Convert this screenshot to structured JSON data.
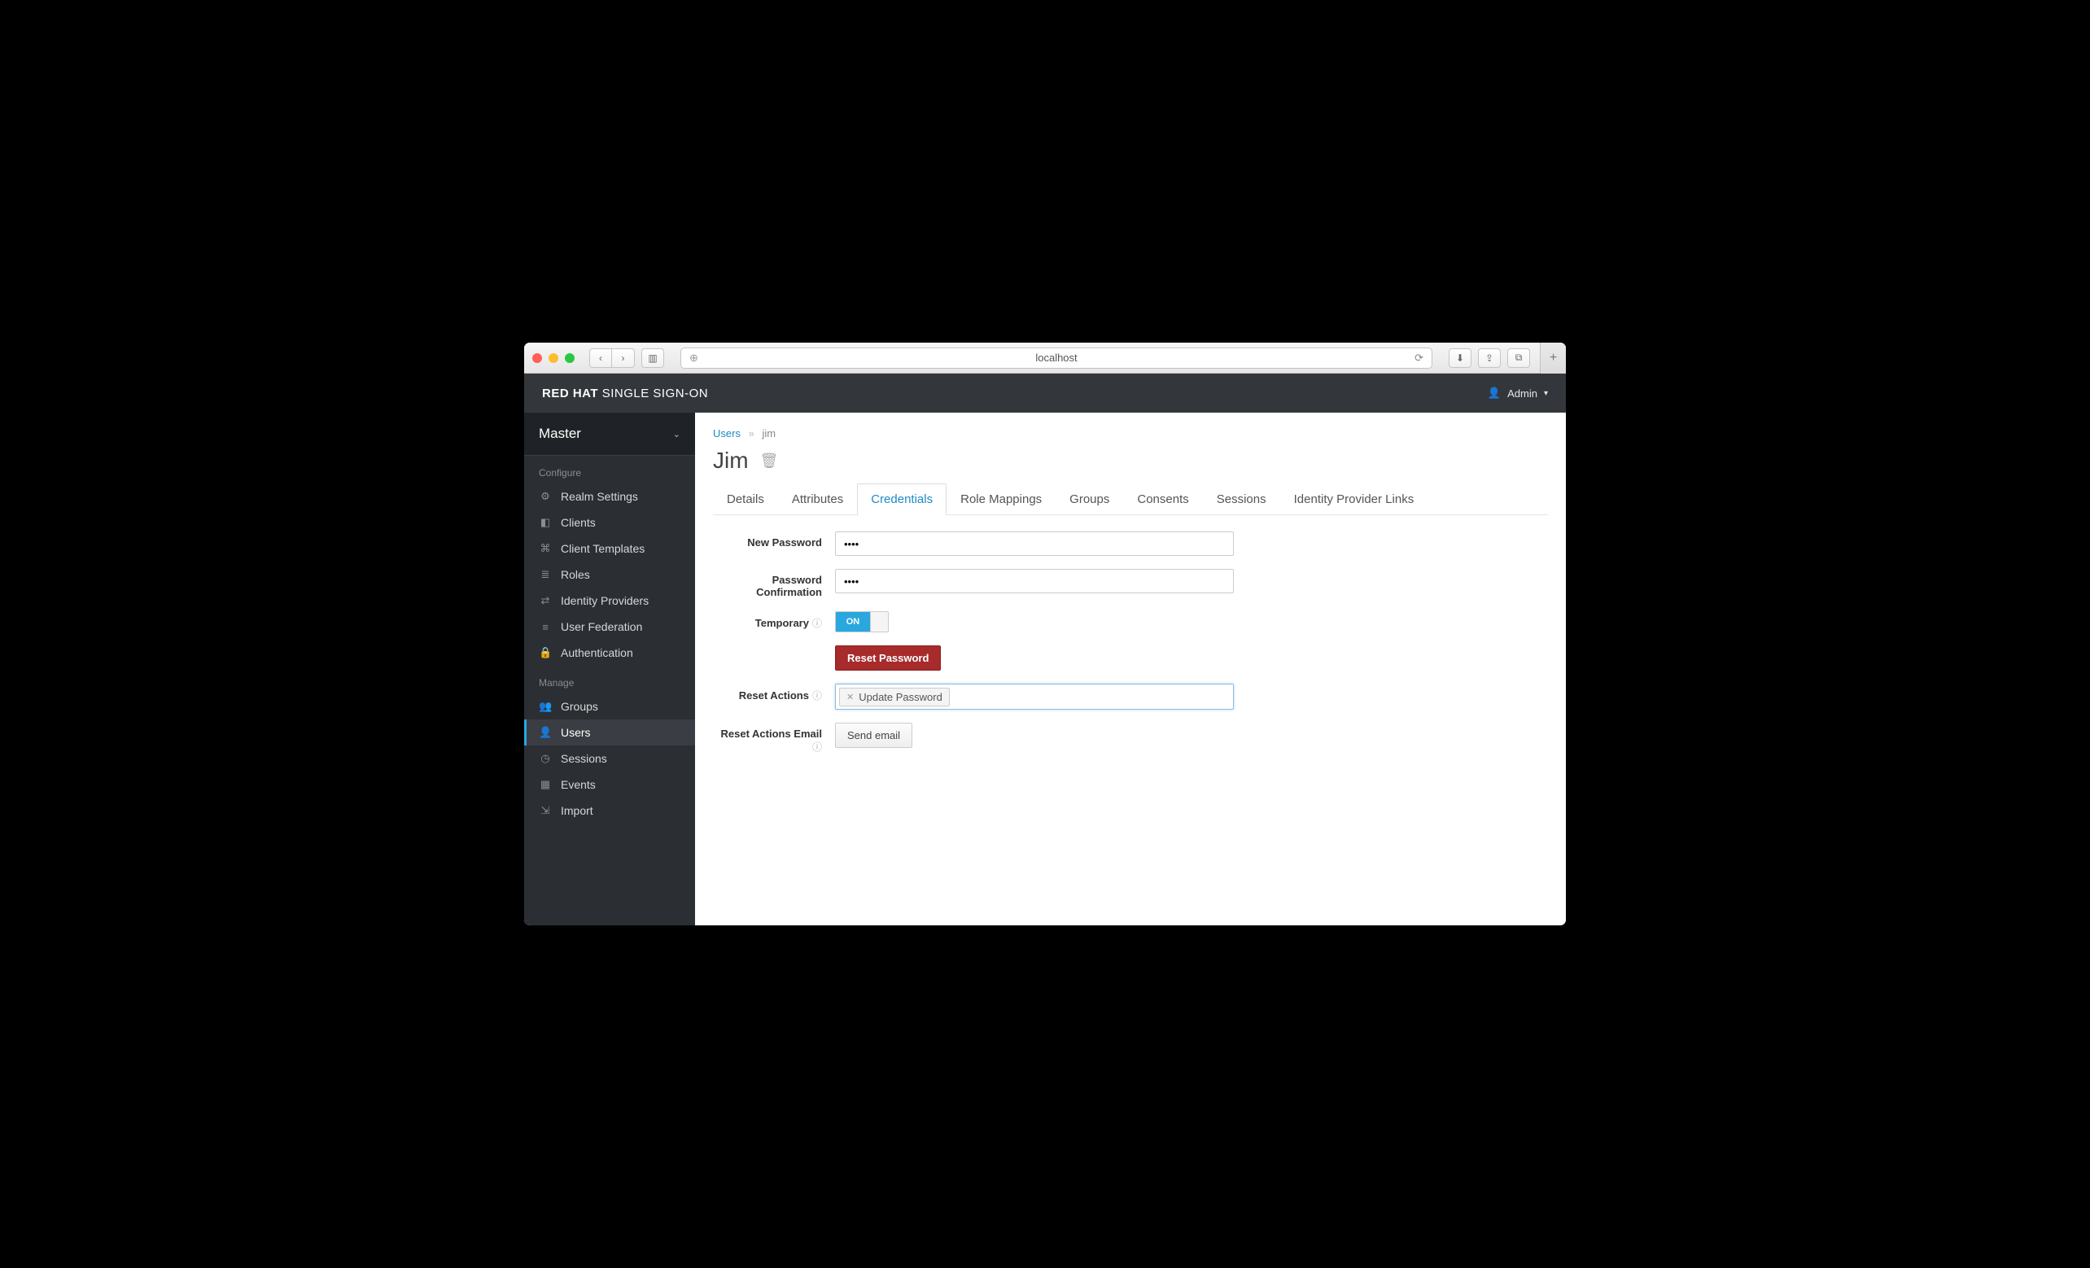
{
  "browser": {
    "url": "localhost"
  },
  "header": {
    "brand_bold": "RED HAT",
    "brand_rest": " SINGLE SIGN-ON",
    "user": "Admin"
  },
  "sidebar": {
    "realm": "Master",
    "section_configure": "Configure",
    "section_manage": "Manage",
    "configure_items": [
      {
        "icon": "⚙",
        "label": "Realm Settings"
      },
      {
        "icon": "◧",
        "label": "Clients"
      },
      {
        "icon": "⌘",
        "label": "Client Templates"
      },
      {
        "icon": "≣",
        "label": "Roles"
      },
      {
        "icon": "⇄",
        "label": "Identity Providers"
      },
      {
        "icon": "≡",
        "label": "User Federation"
      },
      {
        "icon": "🔒",
        "label": "Authentication"
      }
    ],
    "manage_items": [
      {
        "icon": "👥",
        "label": "Groups"
      },
      {
        "icon": "👤",
        "label": "Users",
        "active": true
      },
      {
        "icon": "◷",
        "label": "Sessions"
      },
      {
        "icon": "▦",
        "label": "Events"
      },
      {
        "icon": "⇲",
        "label": "Import"
      }
    ]
  },
  "breadcrumb": {
    "root": "Users",
    "current": "jim"
  },
  "page": {
    "title": "Jim"
  },
  "tabs": [
    "Details",
    "Attributes",
    "Credentials",
    "Role Mappings",
    "Groups",
    "Consents",
    "Sessions",
    "Identity Provider Links"
  ],
  "active_tab": "Credentials",
  "form": {
    "new_password_label": "New Password",
    "new_password_value": "••••",
    "confirm_label_1": "Password",
    "confirm_label_2": "Confirmation",
    "confirm_value": "••••",
    "temporary_label": "Temporary",
    "toggle_on": "ON",
    "reset_password_btn": "Reset Password",
    "reset_actions_label": "Reset Actions",
    "reset_actions_tag": "Update Password",
    "reset_actions_email_label": "Reset Actions Email",
    "send_email_btn": "Send email"
  }
}
